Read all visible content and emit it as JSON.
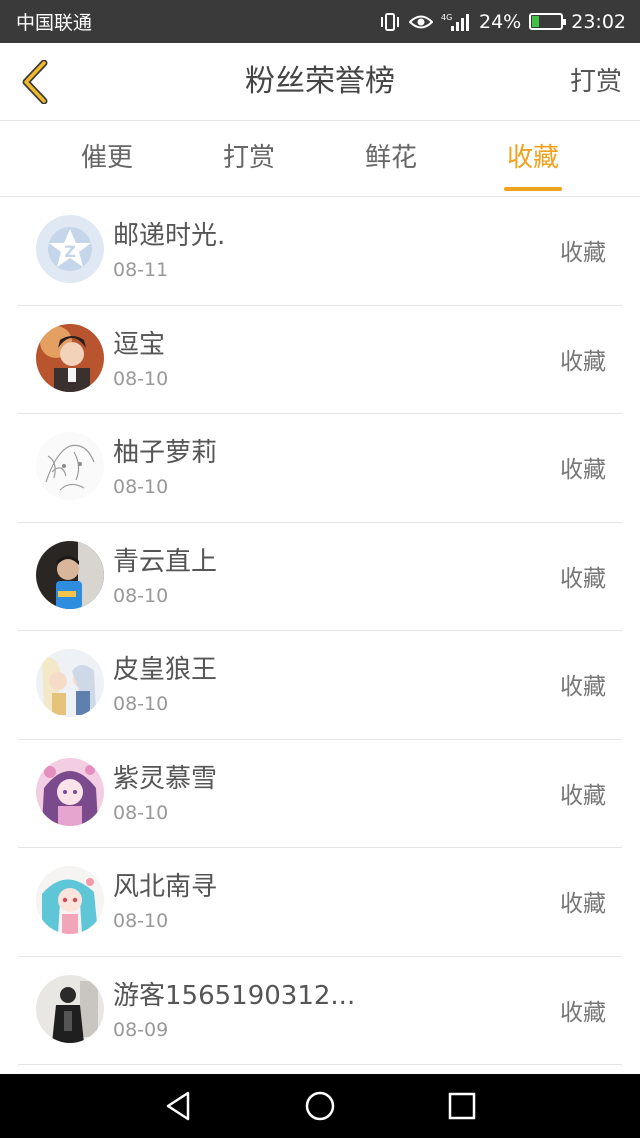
{
  "status_bar": {
    "carrier": "中国联通",
    "network": "4G",
    "battery_percent": "24%",
    "battery_level": 0.24,
    "time": "23:02",
    "icons": [
      "vibrate-icon",
      "eye-icon",
      "signal-icon",
      "battery-icon"
    ]
  },
  "header": {
    "back_icon": "chevron-left-icon",
    "title": "粉丝荣誉榜",
    "action_label": "打赏"
  },
  "tabs": [
    {
      "label": "催更",
      "active": false
    },
    {
      "label": "打赏",
      "active": false
    },
    {
      "label": "鲜花",
      "active": false
    },
    {
      "label": "收藏",
      "active": true
    }
  ],
  "colors": {
    "accent": "#f0a21d",
    "status_bar_bg": "#3a3a3a",
    "text": "#555555",
    "subtext": "#999999",
    "divider": "#e6e6e6"
  },
  "fans": [
    {
      "name": "邮递时光.",
      "date": "08-11",
      "action": "收藏"
    },
    {
      "name": "逗宝",
      "date": "08-10",
      "action": "收藏"
    },
    {
      "name": "柚子萝莉",
      "date": "08-10",
      "action": "收藏"
    },
    {
      "name": "青云直上",
      "date": "08-10",
      "action": "收藏"
    },
    {
      "name": "皮皇狼王",
      "date": "08-10",
      "action": "收藏"
    },
    {
      "name": "紫灵慕雪",
      "date": "08-10",
      "action": "收藏"
    },
    {
      "name": "风北南寻",
      "date": "08-10",
      "action": "收藏"
    },
    {
      "name": "游客1565190312...",
      "date": "08-09",
      "action": "收藏"
    }
  ],
  "system_nav": [
    "back-triangle-icon",
    "home-circle-icon",
    "recents-square-icon"
  ]
}
